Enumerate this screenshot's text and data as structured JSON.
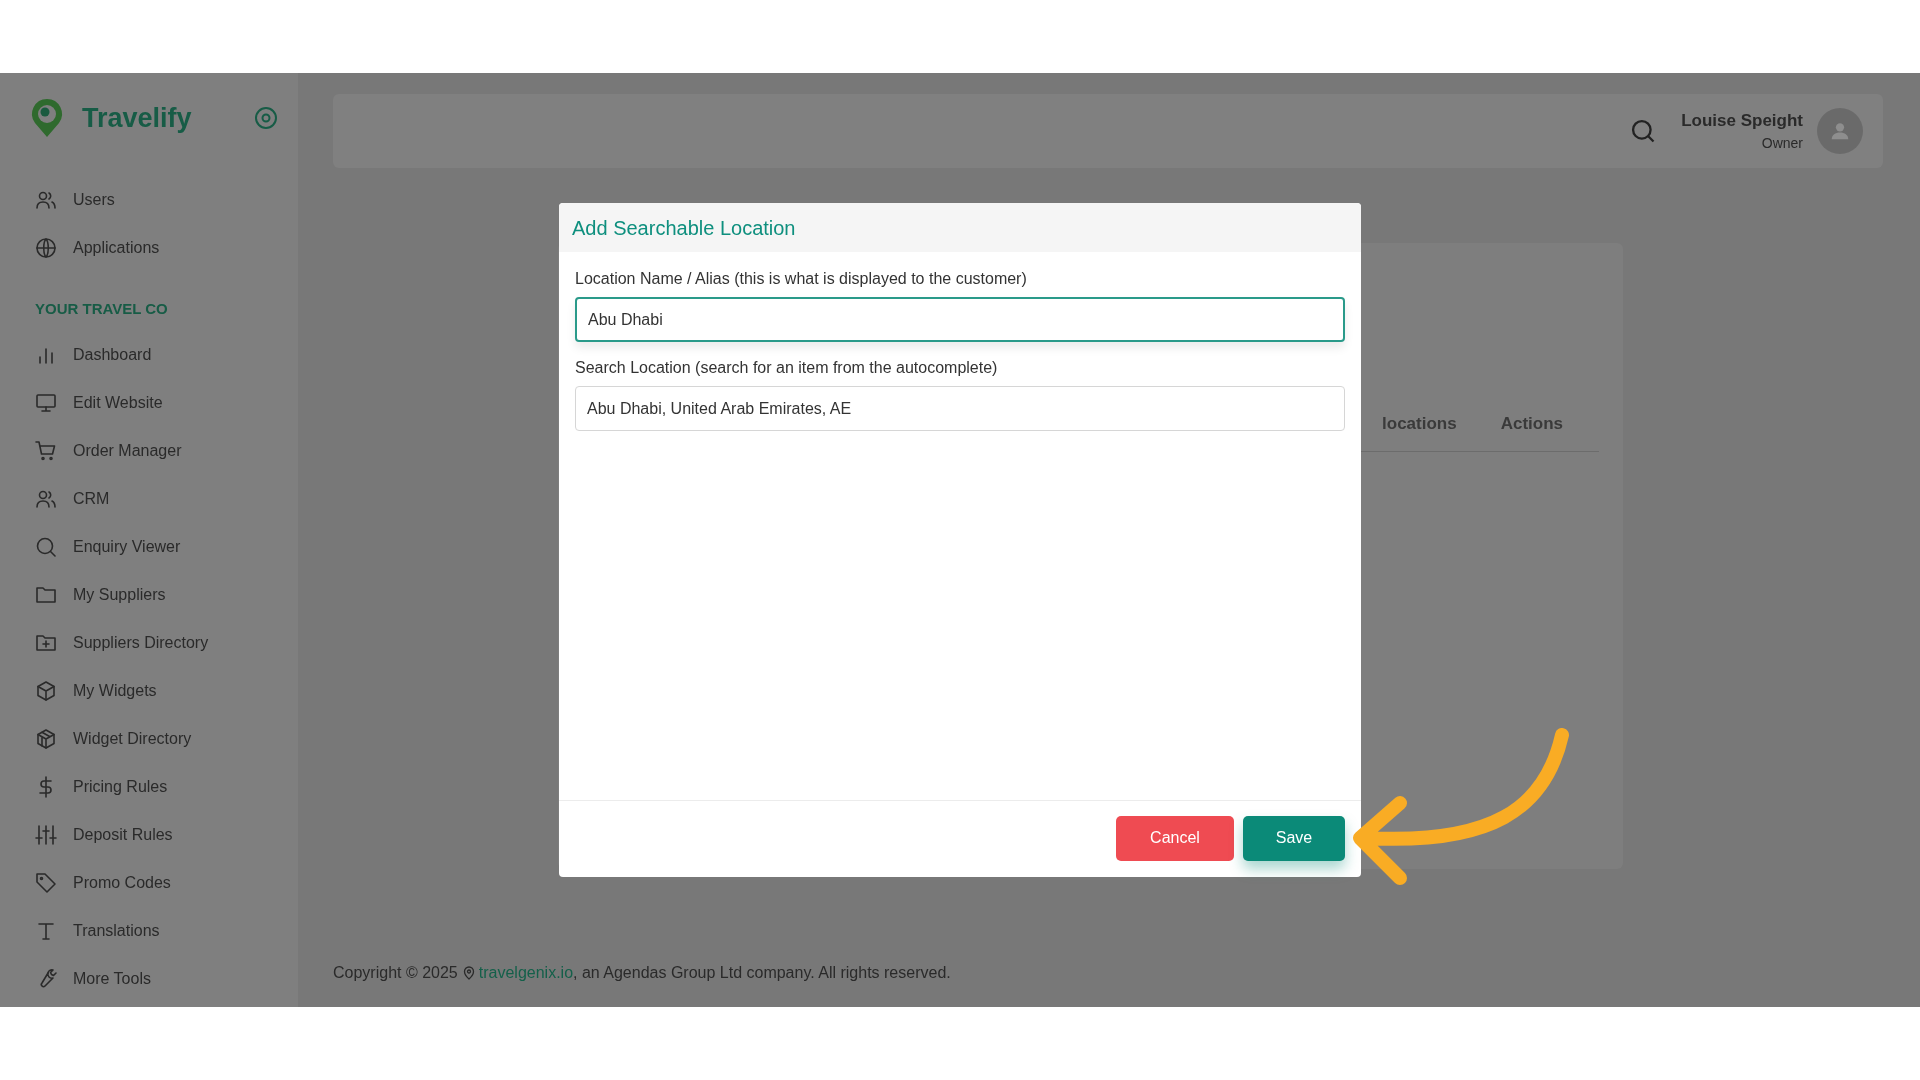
{
  "sidebar": {
    "brand": "Travelify",
    "items": [
      {
        "label": "Users"
      },
      {
        "label": "Applications"
      }
    ],
    "section_title": "YOUR TRAVEL CO",
    "section_items": [
      {
        "label": "Dashboard"
      },
      {
        "label": "Edit Website"
      },
      {
        "label": "Order Manager"
      },
      {
        "label": "CRM"
      },
      {
        "label": "Enquiry Viewer"
      },
      {
        "label": "My Suppliers"
      },
      {
        "label": "Suppliers Directory"
      },
      {
        "label": "My Widgets"
      },
      {
        "label": "Widget Directory"
      },
      {
        "label": "Pricing Rules"
      },
      {
        "label": "Deposit Rules"
      },
      {
        "label": "Promo Codes"
      },
      {
        "label": "Translations"
      },
      {
        "label": "More Tools"
      }
    ]
  },
  "header": {
    "user_name": "Louise Speight",
    "user_role": "Owner"
  },
  "background_table": {
    "columns": [
      "locations",
      "Actions"
    ]
  },
  "dialog": {
    "title": "Add Searchable Location",
    "fields": [
      {
        "label": "Location Name / Alias (this is what is displayed to the customer)",
        "value": "Abu Dhabi",
        "focused": true
      },
      {
        "label": "Search Location (search for an item from the autocomplete)",
        "value": "Abu Dhabi, United Arab Emirates, AE",
        "focused": false
      }
    ],
    "buttons": [
      {
        "label": "Cancel",
        "kind": "cancel"
      },
      {
        "label": "Save",
        "kind": "save"
      }
    ]
  },
  "footer": {
    "text_before": "Copyright © 2025",
    "link": "travelgenix.io",
    "text_after": ", an Agendas Group Ltd company. All rights reserved."
  }
}
